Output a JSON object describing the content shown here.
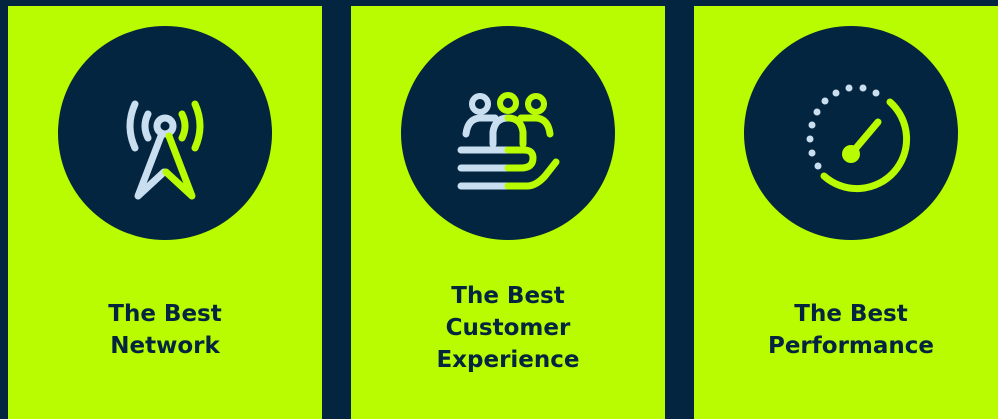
{
  "colors": {
    "background": "#032540",
    "card": "#b9fb00",
    "icon_light": "#c9dff0",
    "icon_accent": "#b9fb00"
  },
  "cards": [
    {
      "icon": "signal-tower-icon",
      "lines": [
        "The Best",
        "Network"
      ]
    },
    {
      "icon": "customer-care-icon",
      "lines": [
        "The Best",
        "Customer",
        "Experience"
      ]
    },
    {
      "icon": "speedometer-icon",
      "lines": [
        "The Best",
        "Performance"
      ]
    }
  ]
}
